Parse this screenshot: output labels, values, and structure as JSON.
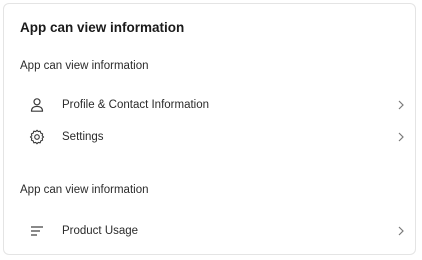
{
  "card": {
    "title": "App can view information"
  },
  "sections": [
    {
      "label": "App can view information",
      "items": [
        {
          "label": "Profile & Contact Information",
          "icon": "person-icon"
        },
        {
          "label": "Settings",
          "icon": "gear-icon"
        }
      ]
    },
    {
      "label": "App can view information",
      "items": [
        {
          "label": "Product Usage",
          "icon": "lines-icon"
        }
      ]
    }
  ],
  "colors": {
    "text": "#2b2b2b",
    "icon": "#3a3a3a",
    "chevron": "#7a7a7a",
    "border": "#e4e4e4"
  }
}
